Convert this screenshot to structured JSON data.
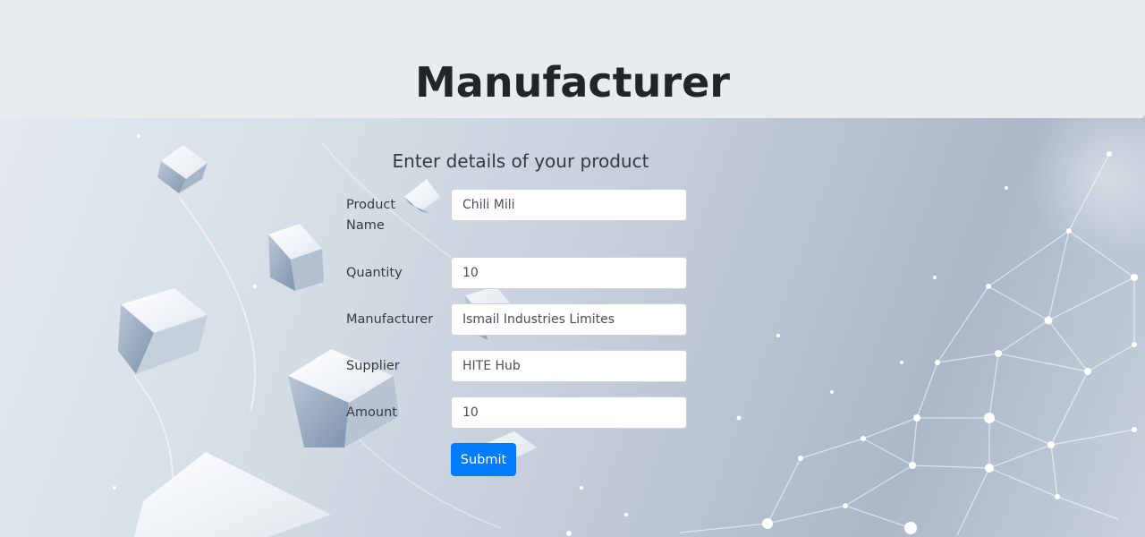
{
  "header": {
    "title": "Manufacturer"
  },
  "form": {
    "heading": "Enter details of your product",
    "fields": [
      {
        "label": "Product Name",
        "value": "Chili Mili"
      },
      {
        "label": "Quantity",
        "value": "10"
      },
      {
        "label": "Manufacturer",
        "value": "Ismail Industries Limites"
      },
      {
        "label": "Supplier",
        "value": "HITE Hub"
      },
      {
        "label": "Amount",
        "value": "10"
      }
    ],
    "submit_label": "Submit"
  },
  "colors": {
    "header_bg": "#e9ecef",
    "primary_button": "#007bff",
    "text": "#212529"
  }
}
